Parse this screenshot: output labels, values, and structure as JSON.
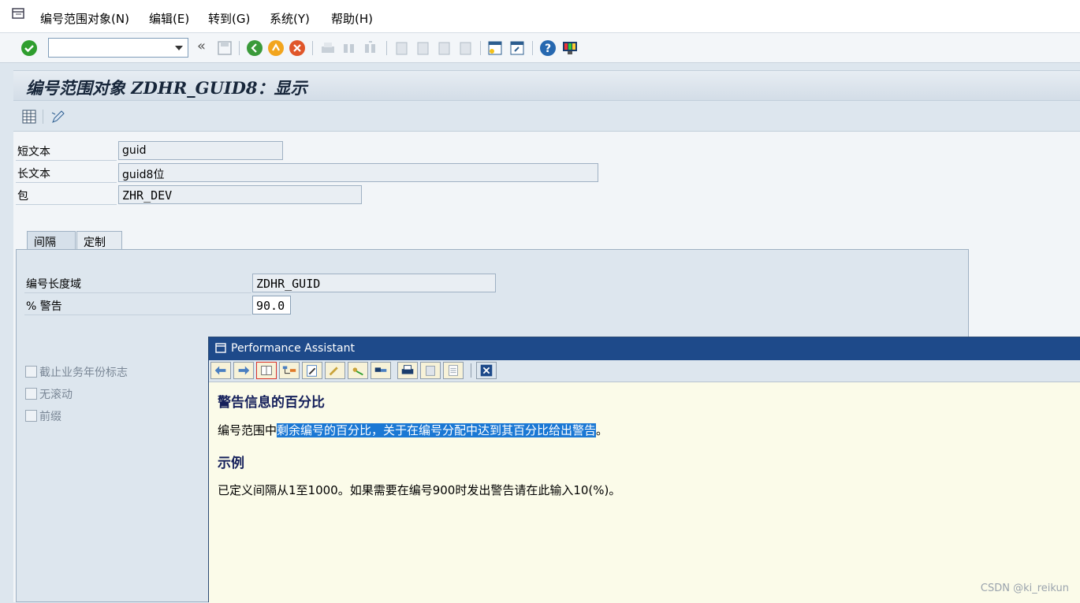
{
  "menu": {
    "items": [
      "编号范围对象(N)",
      "编辑(E)",
      "转到(G)",
      "系统(Y)",
      "帮助(H)"
    ]
  },
  "toolbar": {
    "command_value": "",
    "back_label": "«"
  },
  "page": {
    "title": "编号范围对象 ZDHR_GUID8：显示"
  },
  "fields": {
    "short_text_label": "短文本",
    "short_text_value": "guid",
    "long_text_label": "长文本",
    "long_text_value": "guid8位",
    "package_label": "包",
    "package_value": "ZHR_DEV"
  },
  "tabs": [
    "间隔",
    "定制"
  ],
  "interval": {
    "domain_label": "编号长度域",
    "domain_value": "ZDHR_GUID",
    "warning_label": "% 警告",
    "warning_value": "90.0"
  },
  "checkboxes": [
    "截止业务年份标志",
    "无滚动",
    "前缀"
  ],
  "assistant": {
    "window_title": "Performance Assistant",
    "heading1": "警告信息的百分比",
    "para1_pre": "编号范围中",
    "para1_sel": "剩余编号的百分比，关于在编号分配中达到其百分比给出警告",
    "para1_post": "。",
    "heading2": "示例",
    "para2": "已定义间隔从1至1000。如果需要在编号900时发出警告请在此输入10(%)。"
  },
  "watermark": "CSDN @ki_reikun",
  "colors": {
    "title_bar": "#1e4a8a",
    "selection": "#1b78d4",
    "help_bg": "#fbfbe9"
  }
}
